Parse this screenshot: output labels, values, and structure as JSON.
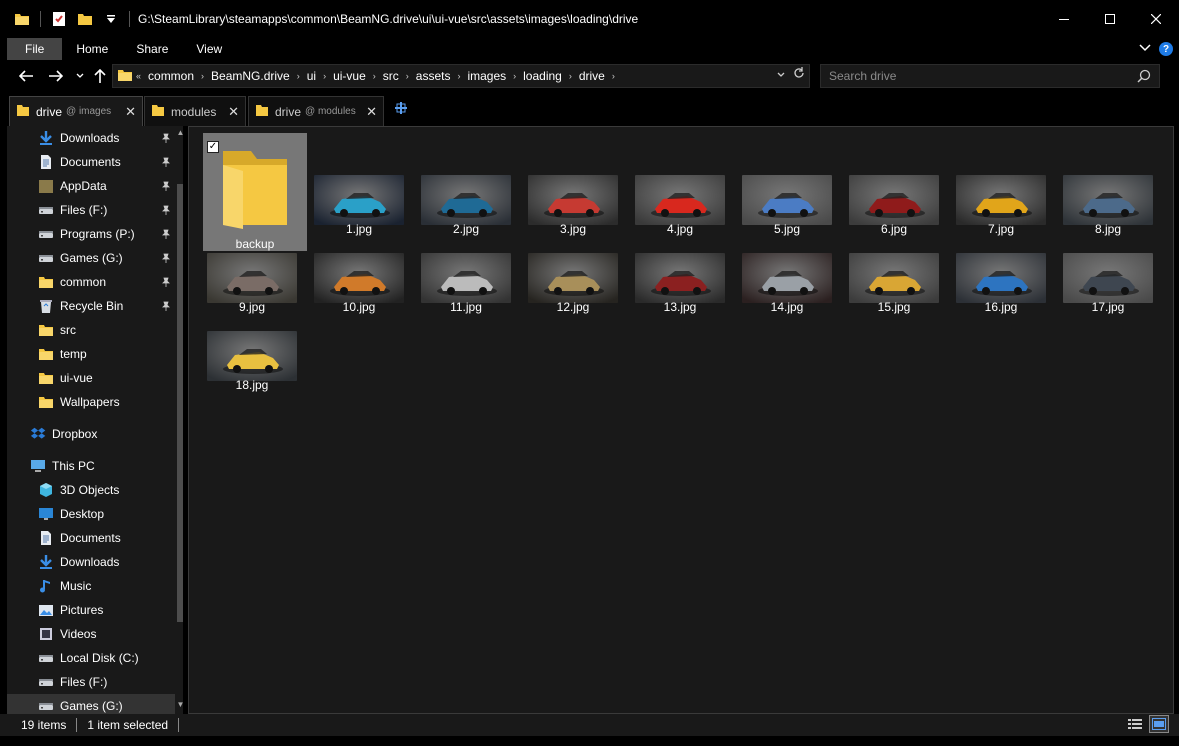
{
  "title_bar": {
    "path": "G:\\SteamLibrary\\steamapps\\common\\BeamNG.drive\\ui\\ui-vue\\src\\assets\\images\\loading\\drive",
    "icons": [
      "folder-icon",
      "checkbox-icon",
      "folder-icon",
      "dropdown-icon"
    ]
  },
  "ribbon": {
    "tabs": [
      "File",
      "Home",
      "Share",
      "View"
    ]
  },
  "address": {
    "overflow": "«",
    "crumbs": [
      "common",
      "BeamNG.drive",
      "ui",
      "ui-vue",
      "src",
      "assets",
      "images",
      "loading",
      "drive"
    ],
    "search_placeholder": "Search drive"
  },
  "tabs": [
    {
      "name": "drive",
      "sub": "@ images",
      "active": true
    },
    {
      "name": "modules",
      "sub": "",
      "active": false
    },
    {
      "name": "drive",
      "sub": "@ modules",
      "active": false
    }
  ],
  "sidebar": {
    "quick_access": [
      {
        "label": "Downloads",
        "icon": "download-arrow-icon",
        "pinned": true
      },
      {
        "label": "Documents",
        "icon": "document-icon",
        "pinned": true
      },
      {
        "label": "AppData",
        "icon": "folder-dark-icon",
        "pinned": true
      },
      {
        "label": "Files (F:)",
        "icon": "drive-icon",
        "pinned": true
      },
      {
        "label": "Programs (P:)",
        "icon": "drive-icon",
        "pinned": true
      },
      {
        "label": "Games (G:)",
        "icon": "drive-icon",
        "pinned": true
      },
      {
        "label": "common",
        "icon": "folder-icon",
        "pinned": true
      },
      {
        "label": "Recycle Bin",
        "icon": "recycle-bin-icon",
        "pinned": true
      },
      {
        "label": "src",
        "icon": "folder-icon",
        "pinned": false
      },
      {
        "label": "temp",
        "icon": "folder-icon",
        "pinned": false
      },
      {
        "label": "ui-vue",
        "icon": "folder-icon",
        "pinned": false
      },
      {
        "label": "Wallpapers",
        "icon": "folder-icon",
        "pinned": false
      }
    ],
    "dropbox": "Dropbox",
    "this_pc": "This PC",
    "pc_items": [
      {
        "label": "3D Objects",
        "icon": "cube-icon"
      },
      {
        "label": "Desktop",
        "icon": "desktop-icon"
      },
      {
        "label": "Documents",
        "icon": "document-icon"
      },
      {
        "label": "Downloads",
        "icon": "download-arrow-icon"
      },
      {
        "label": "Music",
        "icon": "music-note-icon"
      },
      {
        "label": "Pictures",
        "icon": "picture-icon"
      },
      {
        "label": "Videos",
        "icon": "video-icon"
      },
      {
        "label": "Local Disk (C:)",
        "icon": "drive-icon"
      },
      {
        "label": "Files (F:)",
        "icon": "drive-icon"
      },
      {
        "label": "Games (G:)",
        "icon": "drive-icon"
      }
    ]
  },
  "files": [
    {
      "name": "backup",
      "kind": "folder",
      "selected": true
    },
    {
      "name": "1.jpg",
      "kind": "image",
      "car_color": "#2aa0c8",
      "bg": "#1a2230"
    },
    {
      "name": "2.jpg",
      "kind": "image",
      "car_color": "#1f6a95",
      "bg": "#2a2f36"
    },
    {
      "name": "3.jpg",
      "kind": "image",
      "car_color": "#c63a32",
      "bg": "#2c2c2c"
    },
    {
      "name": "4.jpg",
      "kind": "image",
      "car_color": "#d8281e",
      "bg": "#3a3a3a"
    },
    {
      "name": "5.jpg",
      "kind": "image",
      "car_color": "#4b7cc4",
      "bg": "#4a4a4a"
    },
    {
      "name": "6.jpg",
      "kind": "image",
      "car_color": "#8f1b1b",
      "bg": "#3c3c3c"
    },
    {
      "name": "7.jpg",
      "kind": "image",
      "car_color": "#e1a51a",
      "bg": "#2a2a2a"
    },
    {
      "name": "8.jpg",
      "kind": "image",
      "car_color": "#4c6a8a",
      "bg": "#2e3338"
    },
    {
      "name": "9.jpg",
      "kind": "image",
      "car_color": "#7a6c66",
      "bg": "#3a3832"
    },
    {
      "name": "10.jpg",
      "kind": "image",
      "car_color": "#d07a2a",
      "bg": "#222222"
    },
    {
      "name": "11.jpg",
      "kind": "image",
      "car_color": "#bbbbbb",
      "bg": "#333333"
    },
    {
      "name": "12.jpg",
      "kind": "image",
      "car_color": "#a88f5a",
      "bg": "#262420"
    },
    {
      "name": "13.jpg",
      "kind": "image",
      "car_color": "#8b2020",
      "bg": "#2a2a2a"
    },
    {
      "name": "14.jpg",
      "kind": "image",
      "car_color": "#9aa0a6",
      "bg": "#2b2020"
    },
    {
      "name": "15.jpg",
      "kind": "image",
      "car_color": "#d9a634",
      "bg": "#3c3c3c"
    },
    {
      "name": "16.jpg",
      "kind": "image",
      "car_color": "#2d74c0",
      "bg": "#2c3036"
    },
    {
      "name": "17.jpg",
      "kind": "image",
      "car_color": "#3e4650",
      "bg": "#4a4a4a"
    },
    {
      "name": "18.jpg",
      "kind": "image",
      "car_color": "#e8c040",
      "bg": "#2c3034"
    }
  ],
  "status": {
    "items": "19 items",
    "selected": "1 item selected"
  },
  "colors": {
    "folder": "#f5c842",
    "accent": "#1e7be6"
  }
}
